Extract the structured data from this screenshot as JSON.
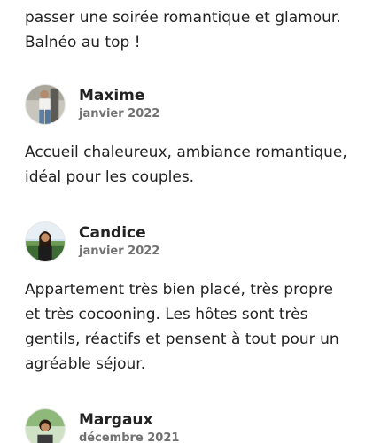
{
  "reviews": [
    {
      "text_lines": [
        "passer une soirée romantique et glamour.",
        "Balnéo au top !"
      ]
    },
    {
      "name": "Maxime",
      "date": "janvier 2022",
      "text_lines": [
        "Accueil chaleureux, ambiance romantique,",
        "idéal pour les couples."
      ]
    },
    {
      "name": "Candice",
      "date": "janvier 2022",
      "text_lines": [
        "Appartement très bien placé, très propre",
        "et très cocooning. Les hôtes sont très",
        "gentils, réactifs et pensent à tout pour un",
        "agréable séjour."
      ]
    },
    {
      "name": "Margaux",
      "date": "décembre 2021"
    }
  ],
  "colors": {
    "text": "#222222",
    "muted": "#717171",
    "background": "#ffffff"
  },
  "icons": {
    "avatar_maxime": "profile-photo",
    "avatar_candice": "profile-photo",
    "avatar_margaux": "profile-photo"
  }
}
